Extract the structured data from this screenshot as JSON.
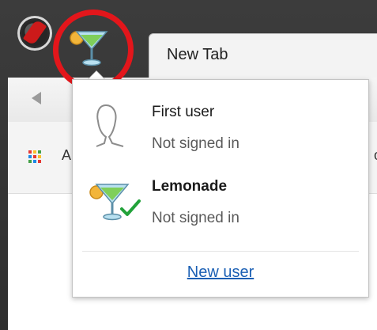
{
  "window": {
    "tab_title": "New Tab",
    "accent_ring_color": "#e3161b"
  },
  "bookmarks": {
    "apps_label_partial": "A",
    "partial_right": "o"
  },
  "profile_menu": {
    "users": [
      {
        "name": "First user",
        "status": "Not signed in",
        "avatar_icon": "person-silhouette-icon",
        "active": false
      },
      {
        "name": "Lemonade",
        "status": "Not signed in",
        "avatar_icon": "cocktail-glass-icon",
        "active": true,
        "active_icon": "checkmark-icon"
      }
    ],
    "new_user_label": "New user"
  },
  "colors": {
    "link": "#1a5fb4",
    "check": "#22a23a"
  }
}
